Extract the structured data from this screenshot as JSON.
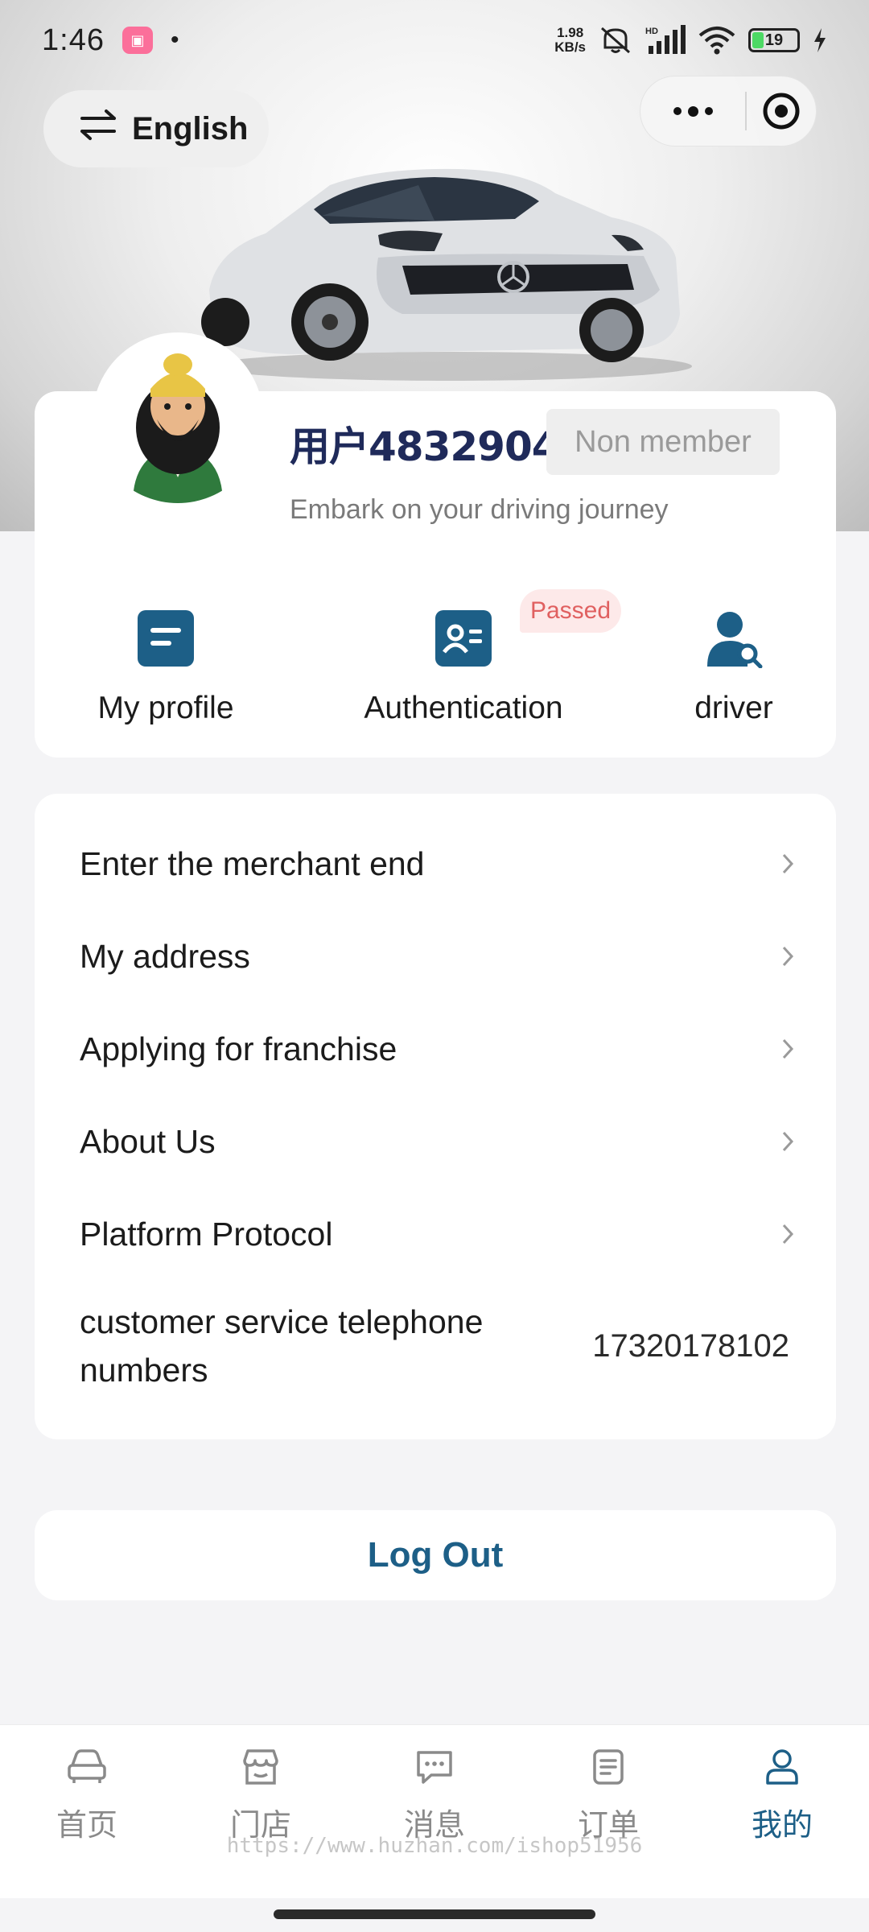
{
  "status_bar": {
    "time": "1:46",
    "net_speed_top": "1.98",
    "net_speed_bottom": "KB/s",
    "network_label": "HD",
    "battery": "19"
  },
  "header": {
    "language_label": "English"
  },
  "profile": {
    "username": "用户4832904",
    "member_status": "Non member",
    "tagline": "Embark on your driving journey"
  },
  "quick_actions": [
    {
      "label": "My profile",
      "icon": "profile-card-icon"
    },
    {
      "label": "Authentication",
      "icon": "id-card-icon",
      "badge": "Passed"
    },
    {
      "label": "driver",
      "icon": "driver-search-icon"
    }
  ],
  "menu": {
    "items": [
      {
        "label": "Enter the merchant end"
      },
      {
        "label": "My address"
      },
      {
        "label": "Applying for franchise"
      },
      {
        "label": "About Us"
      },
      {
        "label": "Platform Protocol"
      }
    ],
    "phone_label": "customer service telephone numbers",
    "phone_value": "17320178102"
  },
  "logout_label": "Log Out",
  "tabbar": {
    "items": [
      {
        "label": "首页",
        "icon": "car-icon"
      },
      {
        "label": "门店",
        "icon": "store-icon"
      },
      {
        "label": "消息",
        "icon": "message-icon"
      },
      {
        "label": "订单",
        "icon": "order-icon"
      },
      {
        "label": "我的",
        "icon": "user-icon"
      }
    ],
    "active_index": 4
  },
  "watermark": "https://www.huzhan.com/ishop51956",
  "colors": {
    "accent": "#1d5f87",
    "badge_text": "#e06060",
    "badge_bg": "#fde9e9"
  }
}
